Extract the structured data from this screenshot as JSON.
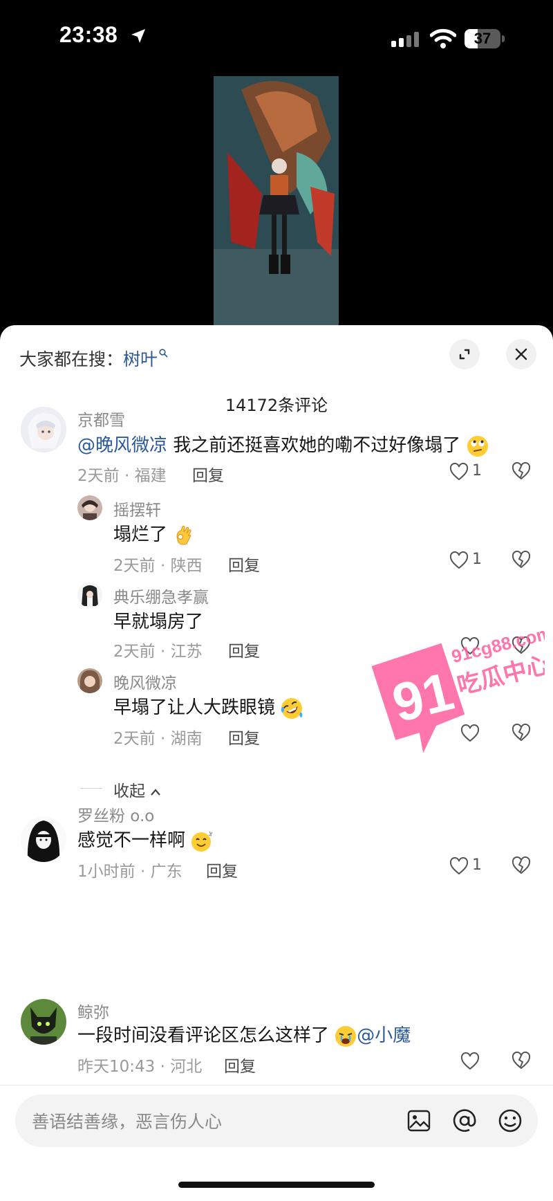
{
  "status_bar": {
    "time": "23:38",
    "battery": "37",
    "battery_fraction": 0.37
  },
  "trending": {
    "prefix": "大家都在搜：",
    "keyword": "树叶"
  },
  "comment_count": "14172条评论",
  "colors": {
    "mention": "#2b5a9a",
    "watermark": "#ff5f9e"
  },
  "comments": [
    {
      "name": "京都雪",
      "mention": "@晚风微凉",
      "text": " 我之前还挺喜欢她的嘞不过好像塌了",
      "emoji": "rolling-eyes-emoji",
      "meta": "2天前 · 福建",
      "reply": "回复",
      "likes": "1",
      "replies": [
        {
          "name": "摇摆轩",
          "text": "塌烂了",
          "emoji": "ok-hand-emoji",
          "meta": "2天前 · 陕西",
          "reply": "回复",
          "likes": "1"
        },
        {
          "name": "典乐绷急孝赢",
          "text": "早就塌房了",
          "meta": "2天前 · 江苏",
          "reply": "回复",
          "likes": ""
        },
        {
          "name": "晚风微凉",
          "text": "早塌了让人大跌眼镜",
          "emoji": "rofl-emoji",
          "meta": "2天前 · 湖南",
          "reply": "回复",
          "likes": ""
        }
      ],
      "collapse_label": "收起"
    },
    {
      "name": "罗丝粉 o.o",
      "text": "感觉不一样啊",
      "emoji": "dizzy-smile-emoji",
      "meta": "1小时前 · 广东",
      "reply": "回复",
      "likes": "1"
    },
    {
      "name": "鲸弥",
      "text": "一段时间没看评论区怎么这样了",
      "emoji": "crying-emoji",
      "mention": "@小魔",
      "meta": "昨天10:43 · 河北",
      "reply": "回复",
      "likes": ""
    }
  ],
  "watermark": {
    "number": "91",
    "domain": "91cg88.com",
    "brand": "吃瓜中心"
  },
  "input": {
    "placeholder": "善语结善缘，恶言伤人心"
  }
}
